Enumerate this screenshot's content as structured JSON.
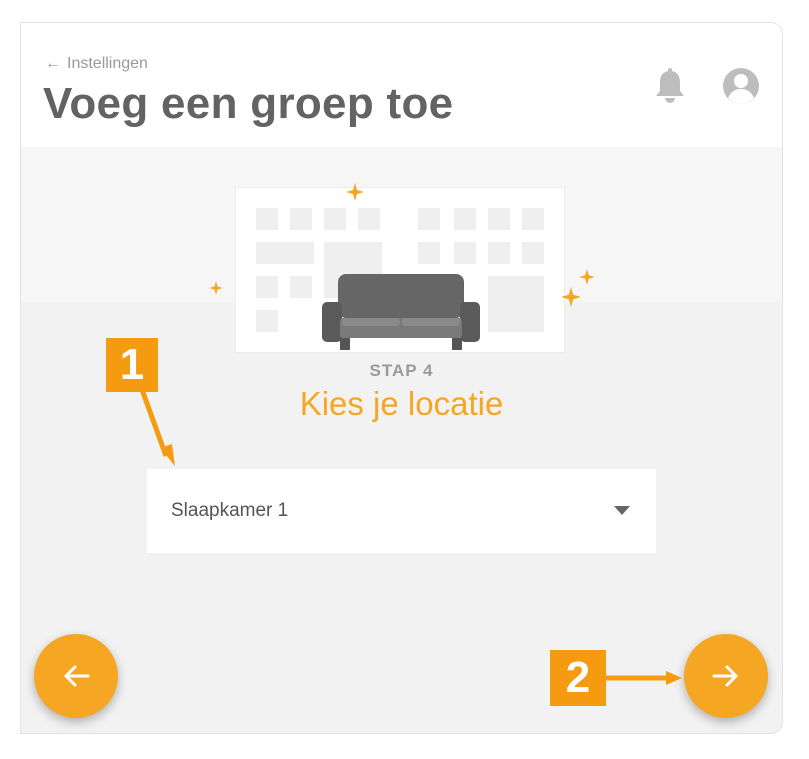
{
  "header": {
    "back_label": "Instellingen",
    "title": "Voeg een groep toe",
    "icons": [
      "arrow-left-icon",
      "bell-icon",
      "user-avatar-icon"
    ]
  },
  "illustration": {
    "icons": [
      "sofa-icon",
      "sparkle-icon"
    ]
  },
  "step": {
    "label": "STAP 4",
    "title": "Kies je locatie"
  },
  "location_select": {
    "value": "Slaapkamer 1"
  },
  "navigation": {
    "prev_icon": "arrow-left-icon",
    "next_icon": "arrow-right-icon"
  },
  "annotations": {
    "marker_1": "1",
    "marker_2": "2"
  },
  "colors": {
    "accent": "#f5a623",
    "marker": "#f49b12",
    "title_text": "#636363",
    "muted_text": "#9a9a9a"
  }
}
